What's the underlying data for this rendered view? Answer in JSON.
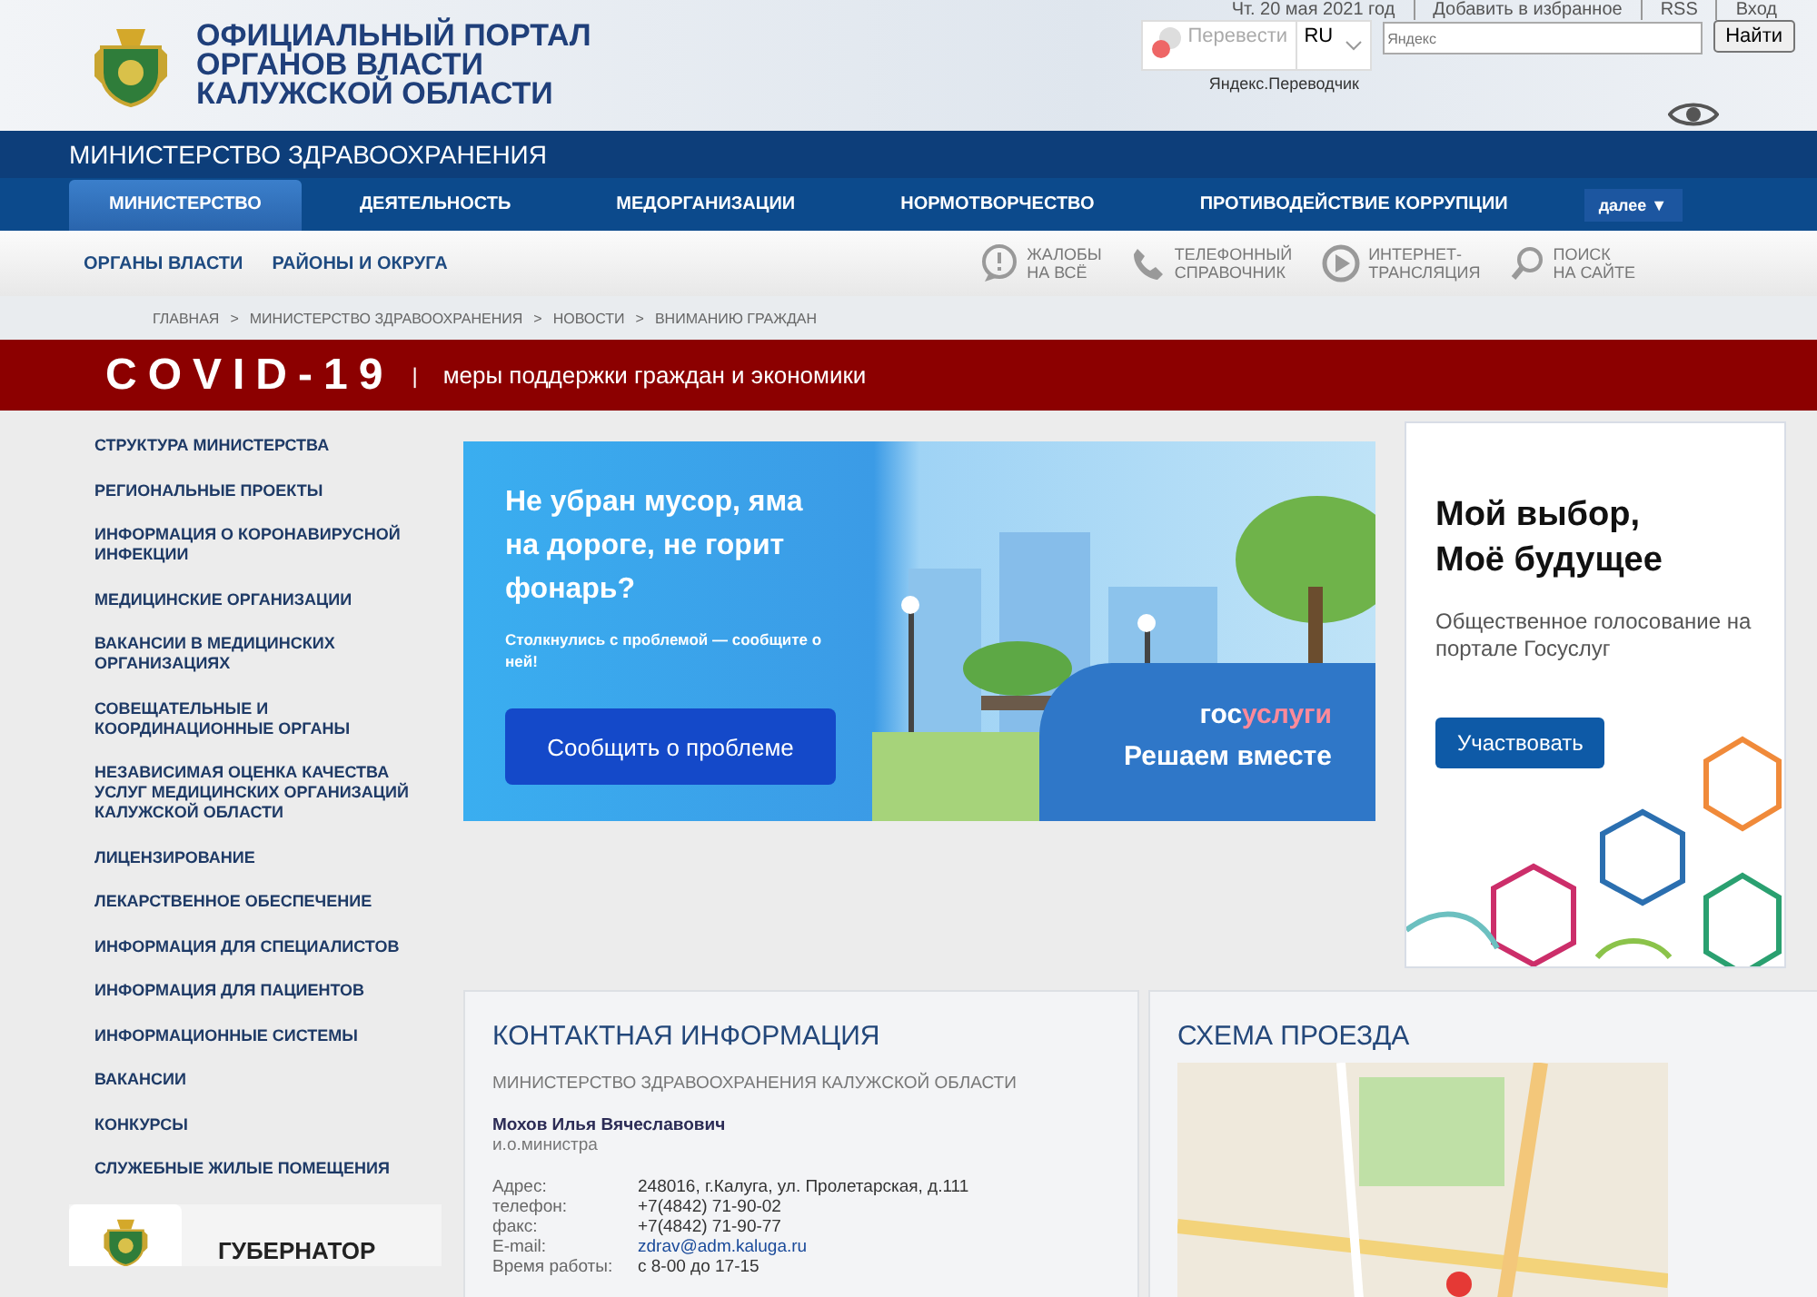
{
  "header": {
    "title_lines": [
      "ОФИЦИАЛЬНЫЙ ПОРТАЛ",
      "ОРГАНОВ ВЛАСТИ",
      "КАЛУЖСКОЙ ОБЛАСТИ"
    ],
    "translate": {
      "button": "Перевести",
      "language": "RU",
      "credit": "Яндекс.Переводчик"
    },
    "top_links": [
      "Чт. 20 мая 2021 год",
      "Добавить в избранное",
      "RSS",
      "Вход"
    ],
    "search": {
      "placeholder": "Яндекс",
      "button": "Найти"
    }
  },
  "ministry_title": "МИНИСТЕРСТВО ЗДРАВООХРАНЕНИЯ",
  "main_nav": [
    {
      "label": "МИНИСТЕРСТВО",
      "selected": true
    },
    {
      "label": "ДЕЯТЕЛЬНОСТЬ",
      "selected": false
    },
    {
      "label": "МЕДОРГАНИЗАЦИИ",
      "selected": false
    },
    {
      "label": "НОРМОТВОРЧЕСТВО",
      "selected": false
    },
    {
      "label": "ПРОТИВОДЕЙСТВИЕ КОРРУПЦИИ",
      "selected": false
    }
  ],
  "more_button": "далее ▼",
  "sub_nav": [
    "ОРГАНЫ ВЛАСТИ",
    "РАЙОНЫ И ОКРУГА"
  ],
  "quick_links": [
    {
      "kind": "complaint",
      "lines": [
        "ЖАЛОБЫ",
        "НА ВСЁ"
      ]
    },
    {
      "kind": "phone",
      "lines": [
        "ТЕЛЕФОННЫЙ",
        "СПРАВОЧНИК"
      ]
    },
    {
      "kind": "stream",
      "lines": [
        "ИНТЕРНЕТ-",
        "ТРАНСЛЯЦИЯ"
      ]
    },
    {
      "kind": "search",
      "lines": [
        "ПОИСК",
        "НА САЙТЕ"
      ]
    }
  ],
  "breadcrumb": [
    "ГЛАВНАЯ",
    "МИНИСТЕРСТВО ЗДРАВООХРАНЕНИЯ",
    "НОВОСТИ",
    "ВНИМАНИЮ ГРАЖДАН"
  ],
  "breadcrumb_separator": ">",
  "covid_bar": {
    "title": "COVID-19",
    "separator": "|",
    "text": "меры поддержки граждан и экономики"
  },
  "sidebar": {
    "items": [
      "СТРУКТУРА МИНИСТЕРСТВА",
      "РЕГИОНАЛЬНЫЕ ПРОЕКТЫ",
      "ИНФОРМАЦИЯ О КОРОНАВИРУСНОЙ ИНФЕКЦИИ",
      "МЕДИЦИНСКИЕ ОРГАНИЗАЦИИ",
      "ВАКАНСИИ В МЕДИЦИНСКИХ ОРГАНИЗАЦИЯХ",
      "СОВЕЩАТЕЛЬНЫЕ И КООРДИНАЦИОННЫЕ ОРГАНЫ",
      "НЕЗАВИСИМАЯ ОЦЕНКА КАЧЕСТВА УСЛУГ МЕДИЦИНСКИХ ОРГАНИЗАЦИЙ КАЛУЖСКОЙ ОБЛАСТИ",
      "ЛИЦЕНЗИРОВАНИЕ",
      "ЛЕКАРСТВЕННОЕ ОБЕСПЕЧЕНИЕ",
      "ИНФОРМАЦИЯ ДЛЯ СПЕЦИАЛИСТОВ",
      "ИНФОРМАЦИЯ ДЛЯ ПАЦИЕНТОВ",
      "ИНФОРМАЦИОННЫЕ СИСТЕМЫ",
      "ВАКАНСИИ",
      "КОНКУРСЫ",
      "СЛУЖЕБНЫЕ ЖИЛЫЕ ПОМЕЩЕНИЯ"
    ],
    "governor": "ГУБЕРНАТОР"
  },
  "banner": {
    "headline": "Не убран мусор, яма на дороге, не горит фонарь?",
    "subtext": "Столкнулись с проблемой — сообщите о ней!",
    "button": "Сообщить о проблеме",
    "logo": [
      "гос",
      "услуги"
    ],
    "slogan": "Решаем вместе"
  },
  "vote_card": {
    "title": "Мой выбор, Моё будущее",
    "text": "Общественное голосование на портале Госуслуг",
    "button": "Участвовать"
  },
  "contacts": {
    "title": "КОНТАКТНАЯ ИНФОРМАЦИЯ",
    "org": "МИНИСТЕРСТВО ЗДРАВООХРАНЕНИЯ КАЛУЖСКОЙ ОБЛАСТИ",
    "person": "Мохов Илья Вячеславович",
    "position": "и.о.министра",
    "rows": [
      {
        "label": "Адрес:",
        "value": "248016, г.Калуга, ул. Пролетарская, д.111",
        "kind": "text"
      },
      {
        "label": "телефон:",
        "value": "+7(4842) 71-90-02",
        "kind": "text"
      },
      {
        "label": "факс:",
        "value": "+7(4842) 71-90-77",
        "kind": "text"
      },
      {
        "label": "E-mail:",
        "value": "zdrav@adm.kaluga.ru",
        "kind": "link"
      },
      {
        "label": "Время работы:",
        "value": "с 8-00 до 17-15",
        "kind": "text"
      }
    ]
  },
  "route": {
    "title": "СХЕМА ПРОЕЗДА"
  }
}
